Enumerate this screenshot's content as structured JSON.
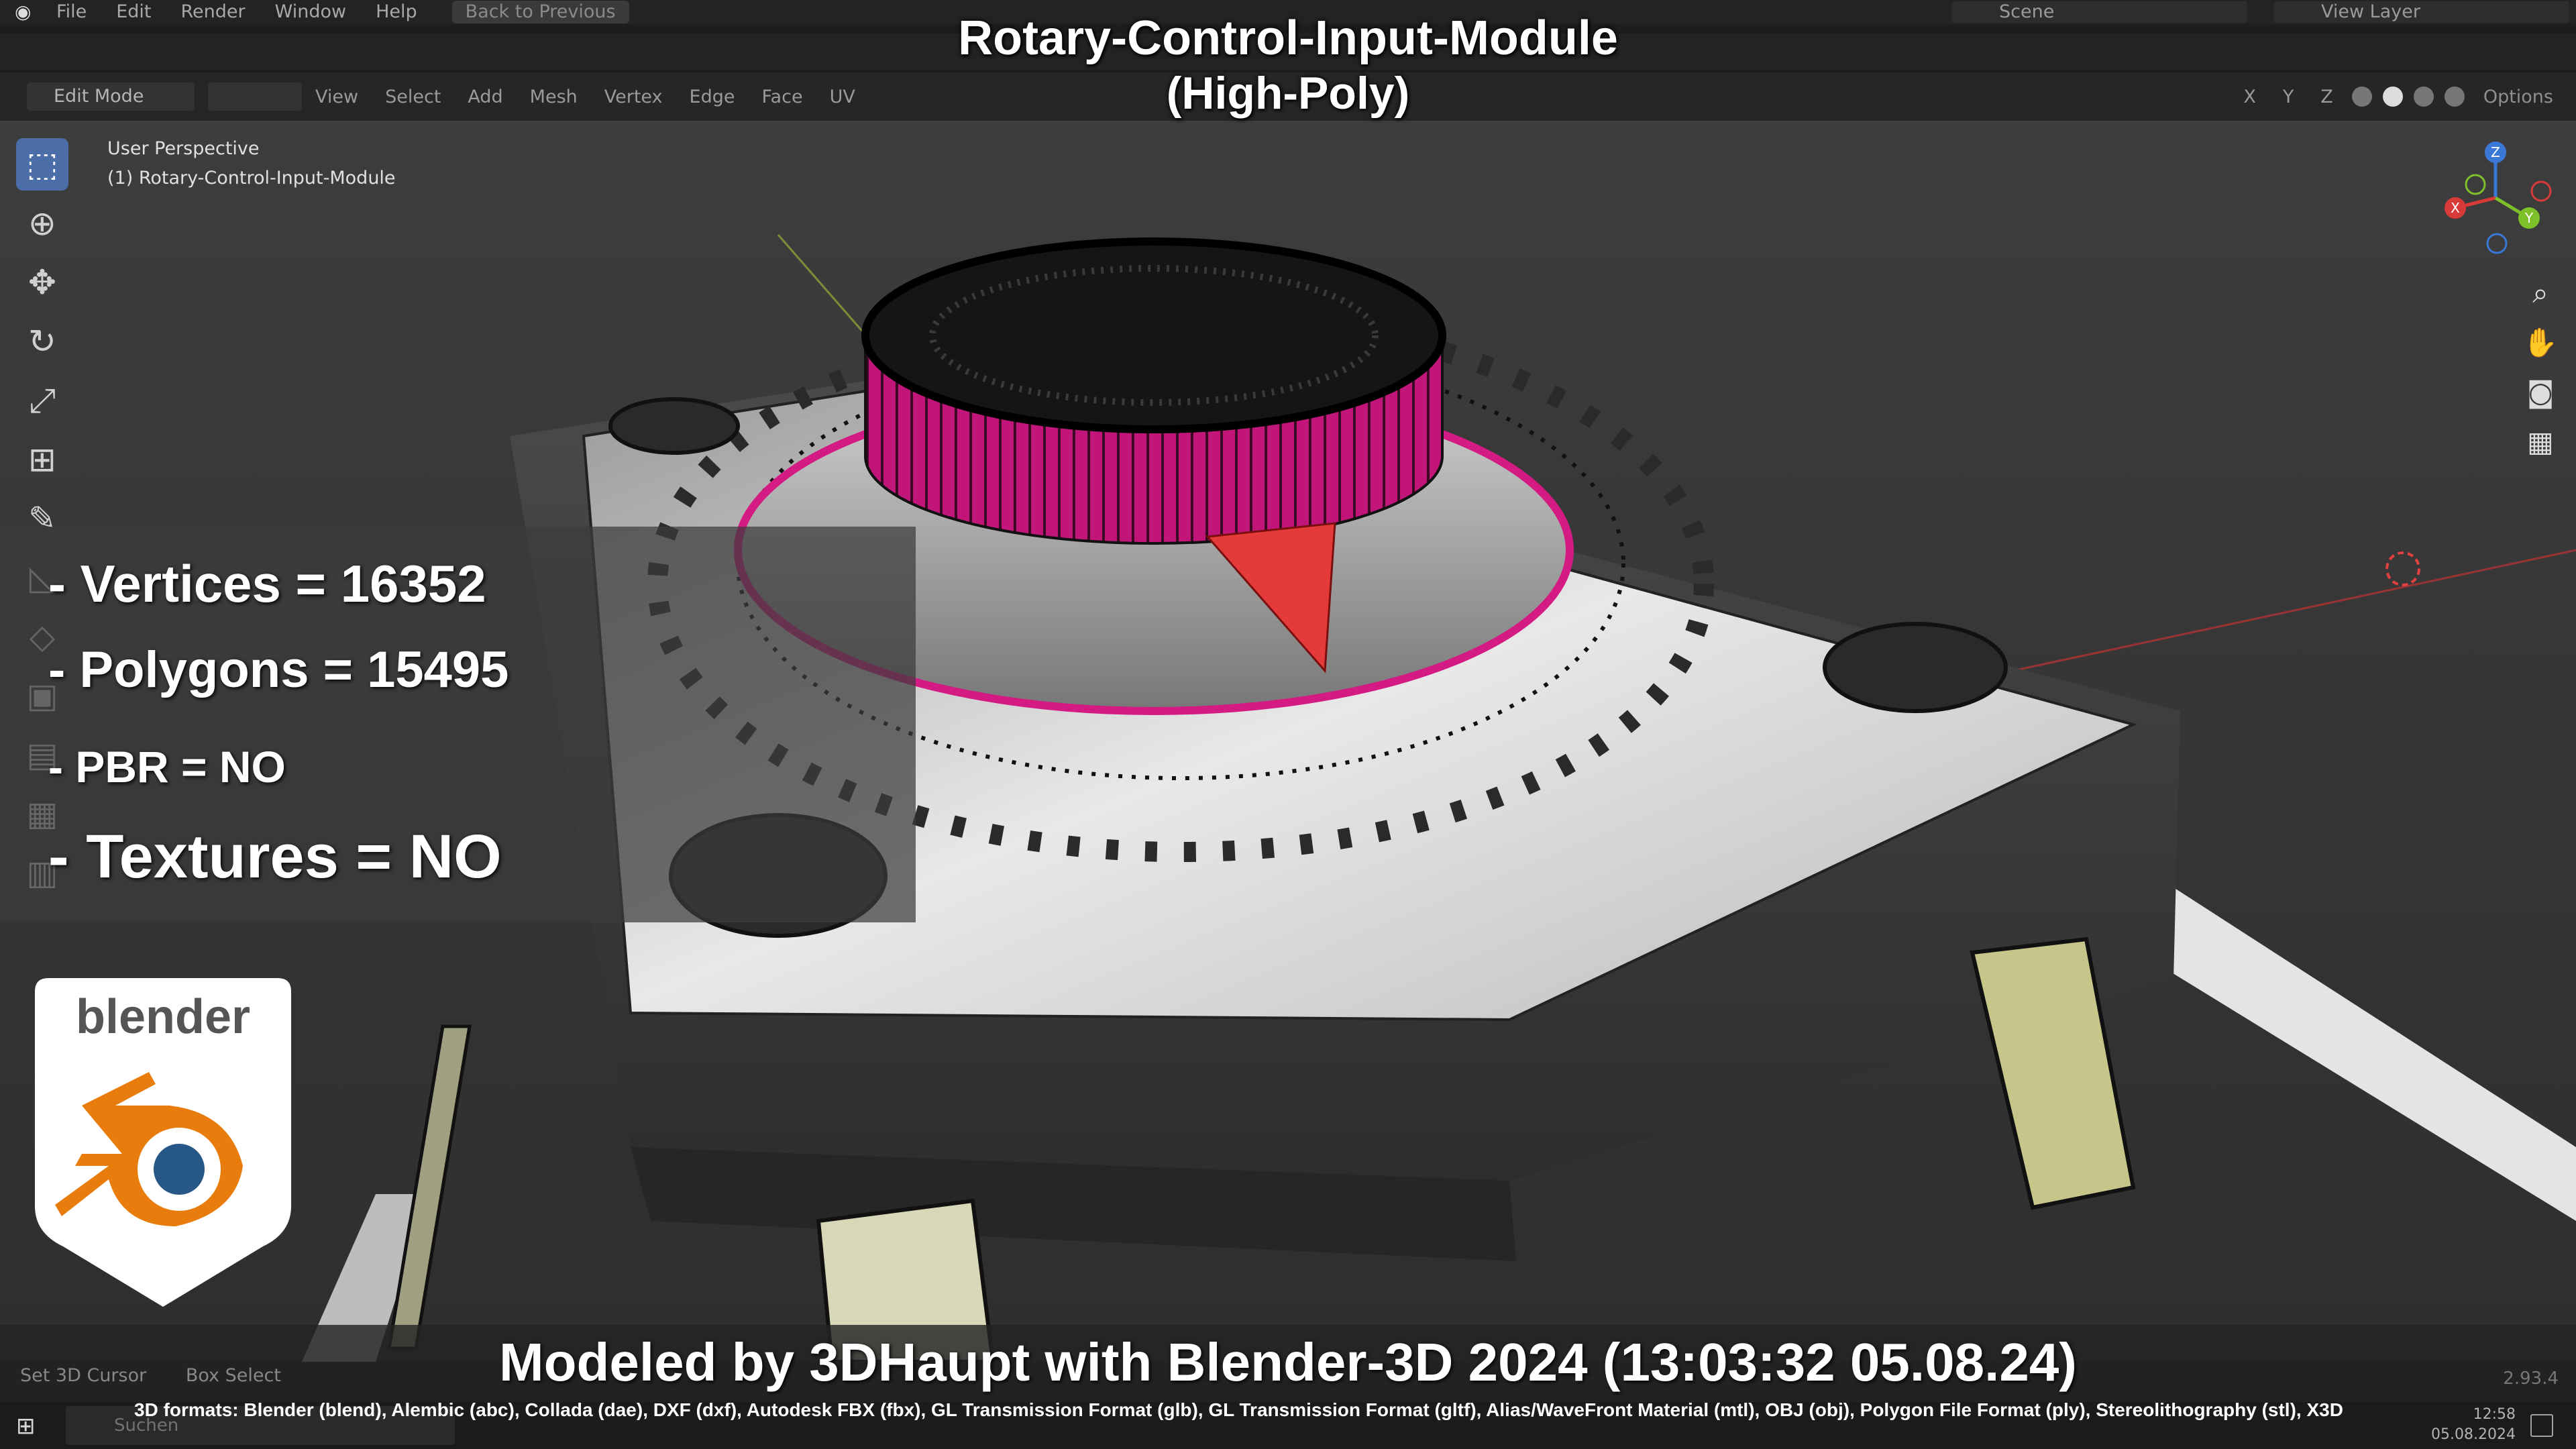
{
  "topbar": {
    "menus": [
      "File",
      "Edit",
      "Render",
      "Window",
      "Help"
    ],
    "back_button": "Back to Previous",
    "scene": "Scene",
    "view_layer": "View Layer"
  },
  "header": {
    "mode": "Edit Mode",
    "menus": [
      "View",
      "Select",
      "Add",
      "Mesh",
      "Vertex",
      "Edge",
      "Face",
      "UV"
    ],
    "axes": [
      "X",
      "Y",
      "Z"
    ],
    "options": "Options"
  },
  "viewport_info": {
    "perspective": "User Perspective",
    "object": "(1) Rotary-Control-Input-Module"
  },
  "gizmo": {
    "x": "X",
    "y": "Y",
    "z": "Z"
  },
  "overlay": {
    "title_line1": "Rotary-Control-Input-Module",
    "title_line2": "(High-Poly)",
    "vertices": "- Vertices = 16352",
    "polygons": "- Polygons = 15495",
    "pbr": "- PBR =  NO",
    "textures": "- Textures = NO",
    "badge_text": "blender",
    "credit": "Modeled by 3DHaupt with Blender-3D 2024 (13:03:32  05.08.24)",
    "formats": "3D formats: Blender (blend), Alembic (abc), Collada (dae), DXF (dxf), Autodesk FBX (fbx), GL Transmission Format (glb), GL Transmission Format (gltf), Alias/WaveFront Material (mtl), OBJ (obj), Polygon File Format (ply), Stereolithography (stl), X3D"
  },
  "status": {
    "set_cursor": "Set 3D Cursor",
    "box_select": "Box Select",
    "version": "2.93.4"
  },
  "taskbar": {
    "search_placeholder": "Suchen",
    "time": "12:58",
    "date": "05.08.2024"
  },
  "colors": {
    "accent": "#4b6ea8",
    "face_select": "#e0127a",
    "active_face": "#e53a3a",
    "blender_orange": "#e87d0d",
    "blender_blue": "#265787"
  }
}
